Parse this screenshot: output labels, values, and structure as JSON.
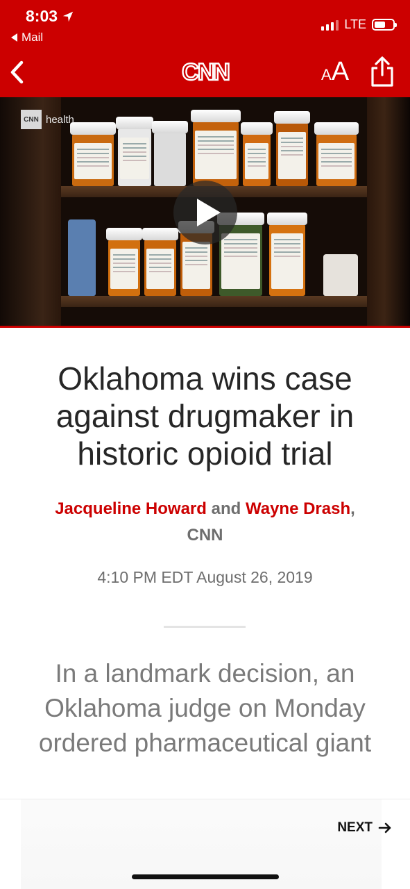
{
  "status_bar": {
    "time": "8:03",
    "back_app": "Mail",
    "network": "LTE",
    "battery_level": 0.6
  },
  "nav": {
    "logo_text": "CNN",
    "font_size_small": "A",
    "font_size_large": "A"
  },
  "video": {
    "badge_logo": "CNN",
    "badge_text": "health"
  },
  "article": {
    "headline": "Oklahoma wins case against drugmaker in historic opioid trial",
    "authors": [
      "Jacqueline Howard",
      "Wayne Drash"
    ],
    "author_joiner": "and",
    "author_suffix": ",",
    "outlet": "CNN",
    "timestamp": "4:10 PM EDT August 26, 2019",
    "lead": "In a landmark decision, an Oklahoma judge on Monday ordered pharmaceutical giant"
  },
  "footer": {
    "next_label": "NEXT"
  },
  "colors": {
    "brand_red": "#cc0000",
    "headline": "#262626",
    "muted": "#6e6e6e"
  },
  "icons": [
    "location-arrow-icon",
    "back-chevron-icon",
    "cnn-logo",
    "share-icon",
    "play-icon",
    "arrow-right-icon"
  ]
}
